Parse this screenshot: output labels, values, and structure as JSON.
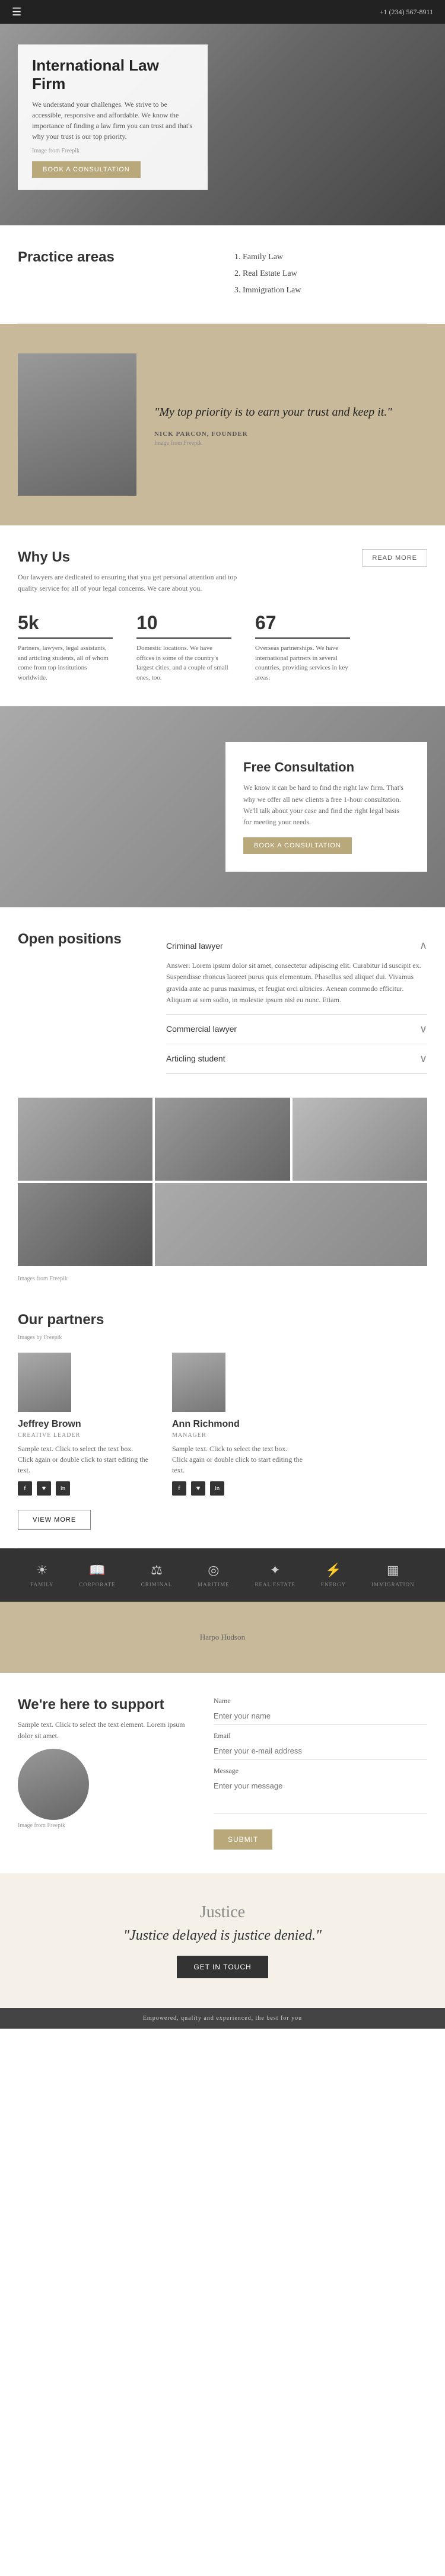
{
  "header": {
    "menu_label": "☰",
    "phone": "+1 (234) 567-8911"
  },
  "hero": {
    "title": "International Law Firm",
    "description": "We understand your challenges. We strive to be accessible, responsive and affordable. We know the importance of finding a law firm you can trust and that's why your trust is our top priority.",
    "image_credit": "Image from Freepik",
    "consult_btn": "BOOK A CONSULTATION"
  },
  "practice_areas": {
    "title": "Practice areas",
    "items": [
      "1. Family Law",
      "2. Real Estate Law",
      "3. Immigration Law"
    ]
  },
  "quote_section": {
    "text": "\"My top priority is to earn your trust and keep it.\"",
    "author": "NICK PARCON, FOUNDER",
    "image_credit": "Image from Freepik"
  },
  "why_us": {
    "title": "Why Us",
    "description": "Our lawyers are dedicated to ensuring that you get personal attention and top quality service for all of your legal concerns. We care about you.",
    "read_more_btn": "READ MORE",
    "stats": [
      {
        "number": "5k",
        "desc": "Partners, lawyers, legal assistants, and articling students, all of whom come from top institutions worldwide."
      },
      {
        "number": "10",
        "desc": "Domestic locations. We have offices in some of the country's largest cities, and a couple of small ones, too."
      },
      {
        "number": "67",
        "desc": "Overseas partnerships. We have international partners in several countries, providing services in key areas."
      }
    ]
  },
  "free_consult": {
    "title": "Free Consultation",
    "description": "We know it can be hard to find the right law firm. That's why we offer all new clients a free 1-hour consultation. We'll talk about your case and find the right legal basis for meeting your needs.",
    "btn": "BOOK A CONSULTATION"
  },
  "open_positions": {
    "title": "Open positions",
    "positions": [
      {
        "title": "Criminal lawyer",
        "open": true,
        "content": "Answer: Lorem ipsum dolor sit amet, consectetur adipiscing elit. Curabitur id suscipit ex. Suspendisse rhoncus laoreet purus quis elementum. Phasellus sed aliquet dui. Vivamus gravida ante ac purus maximus, et feugiat orci ultricies. Aenean commodo efficitur. Aliquam at sem sodio, in molestie ipsum nisl eu nunc. Etiam."
      },
      {
        "title": "Commercial lawyer",
        "open": false,
        "content": ""
      },
      {
        "title": "Articling student",
        "open": false,
        "content": ""
      }
    ]
  },
  "photos": {
    "credit": "Images from Freepik"
  },
  "partners": {
    "title": "Our partners",
    "credit": "Images by Freepik",
    "items": [
      {
        "name": "Jeffrey Brown",
        "role": "CREATIVE LEADER",
        "desc": "Sample text. Click to select the text box. Click again or double click to start editing the text.",
        "social": [
          "f",
          "♥",
          "in"
        ]
      },
      {
        "name": "Ann Richmond",
        "role": "MANAGER",
        "desc": "Sample text. Click to select the text box. Click again or double click to start editing the text.",
        "social": [
          "f",
          "♥",
          "in"
        ]
      }
    ],
    "view_more_btn": "VIEW MORE"
  },
  "icon_row": {
    "items": [
      {
        "symbol": "☀",
        "label": "FAMILY"
      },
      {
        "symbol": "📖",
        "label": "CORPORATE"
      },
      {
        "symbol": "⚖",
        "label": "CRIMINAL"
      },
      {
        "symbol": "◎",
        "label": "MARITIME"
      },
      {
        "symbol": "✦",
        "label": "REAL ESTATE"
      },
      {
        "symbol": "⚡",
        "label": "ENERGY"
      },
      {
        "symbol": "▦",
        "label": "IMMIGRATION"
      }
    ]
  },
  "map": {
    "location": "Harpo Hudson"
  },
  "support": {
    "title": "We're here to support",
    "description": "Sample text. Click to select the text element. Lorem ipsum dolor sit amet.",
    "image_credit": "Image from Freepik",
    "form": {
      "name_label": "Name",
      "name_placeholder": "Enter your name",
      "email_label": "Email",
      "email_placeholder": "Enter your e-mail address",
      "message_label": "Message",
      "message_placeholder": "Enter your message",
      "submit_btn": "SUBMIT"
    }
  },
  "quote_footer": {
    "script_text": "Justice",
    "quote": "\"Justice delayed is justice denied.\"",
    "btn": "GET IN TOUCH"
  },
  "footer": {
    "text": "Empowered, quality and experienced, the best for you"
  }
}
